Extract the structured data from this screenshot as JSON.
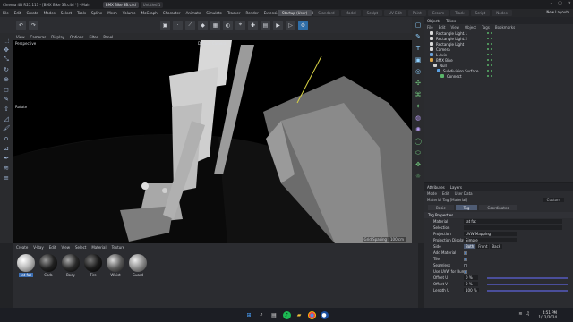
{
  "titlebar": {
    "app_title": "Cinema 4D R25.117 - [BMX Bike 3B.c4d *] - Main",
    "tabs": [
      "BMX Bike 3B.c4d",
      "Untitled 1"
    ],
    "minimize_icon": "minimize-icon",
    "maximize_icon": "maximize-icon",
    "close_icon": "close-icon"
  },
  "menubar": {
    "items": [
      "File",
      "Edit",
      "Create",
      "Modes",
      "Select",
      "Tools",
      "Spline",
      "Mesh",
      "Volume",
      "MoGraph",
      "Character",
      "Animate",
      "Simulate",
      "Tracker",
      "Render",
      "Extensions",
      "V-Ray",
      "Window",
      "Help"
    ],
    "layouts": [
      "Startup (User)",
      "Standard",
      "Model",
      "Sculpt",
      "UV Edit",
      "Paint",
      "Groom",
      "Track",
      "Script",
      "Nodes"
    ],
    "new_layouts": "New Layouts"
  },
  "viewport": {
    "menu": [
      "View",
      "Cameras",
      "Display",
      "Options",
      "Filter",
      "Panel"
    ],
    "projection": "Perspective",
    "camera": "Default Camera",
    "tool": "Rotate",
    "grid_spacing": "Grid Spacing : 100 cm"
  },
  "objects": {
    "tabs": [
      "Objects",
      "Takes"
    ],
    "menu": [
      "File",
      "Edit",
      "View",
      "Object",
      "Tags",
      "Bookmarks"
    ],
    "rows": [
      {
        "name": "Rectangle Light.1",
        "color": "#d9d9d9"
      },
      {
        "name": "Rectangle Light.2",
        "color": "#d9d9d9"
      },
      {
        "name": "Rectangle Light",
        "color": "#d9d9d9"
      },
      {
        "name": "Camera",
        "color": "#d9d9d9"
      },
      {
        "name": "L-Axis",
        "color": "#6aa0d8"
      },
      {
        "name": "BMX Bike",
        "color": "#d9a44a"
      },
      {
        "name": "Null",
        "color": "#cfcfcf"
      },
      {
        "name": "Subdivision Surface",
        "color": "#5aa0e0"
      },
      {
        "name": "Connect",
        "color": "#5ab56a"
      }
    ]
  },
  "attributes": {
    "tabs": [
      "Attributes",
      "Layers"
    ],
    "menu": [
      "Mode",
      "Edit",
      "User Data"
    ],
    "title": "Material Tag [Material]",
    "mode": "Custom",
    "subtabs": [
      "Basic",
      "Tag",
      "Coordinates"
    ],
    "section": "Tag Properties",
    "rows": [
      {
        "label": "Material",
        "value": "lat fat"
      },
      {
        "label": "Selection",
        "value": ""
      },
      {
        "label": "Projection",
        "value": "UVW Mapping"
      },
      {
        "label": "Projection Display",
        "value": "Simple"
      },
      {
        "label": "Side",
        "value": "Both"
      },
      {
        "label": "Add Material",
        "check": true
      },
      {
        "label": "Tile",
        "check": true
      },
      {
        "label": "Seamless",
        "check": false
      },
      {
        "label": "Use UVW for Bump",
        "check": true
      },
      {
        "label": "Offset U",
        "value": "0 %"
      },
      {
        "label": "Offset V",
        "value": "0 %"
      },
      {
        "label": "Length U",
        "value": "100 %"
      }
    ],
    "side_options": [
      "Both",
      "Front",
      "Back"
    ]
  },
  "material_manager": {
    "menu": [
      "Create",
      "V-Ray",
      "Edit",
      "View",
      "Select",
      "Material",
      "Texture"
    ],
    "materials": [
      {
        "name": "lat fat",
        "color": "#cfcfcf",
        "selected": true
      },
      {
        "name": "Carb",
        "color": "#222"
      },
      {
        "name": "Body",
        "color": "#2a2a2a"
      },
      {
        "name": "Tire",
        "color": "#1a1a1a"
      },
      {
        "name": "Whist",
        "color": "#5a5a5a"
      },
      {
        "name": "Guard",
        "color": "#8a8a8a"
      }
    ]
  },
  "taskbar": {
    "time": "4:51 PM",
    "date": "1/12/2024",
    "icons": [
      "windows-icon",
      "search-icon",
      "files-icon",
      "spotify-icon",
      "explorer-icon",
      "chrome-icon",
      "cinema4d-icon"
    ]
  }
}
